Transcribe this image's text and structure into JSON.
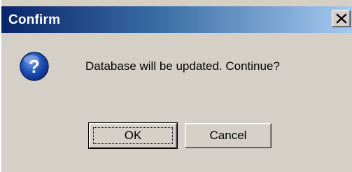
{
  "dialog": {
    "title": "Confirm",
    "close_glyph": "X",
    "message": "Database will be updated. Continue?",
    "icon": "question-icon",
    "buttons": {
      "ok_label": "OK",
      "cancel_label": "Cancel"
    }
  },
  "colors": {
    "titlebar_start": "#0a246a",
    "titlebar_end": "#a6caf0",
    "face": "#d4d0c8",
    "icon_blue": "#1f4fb5"
  }
}
